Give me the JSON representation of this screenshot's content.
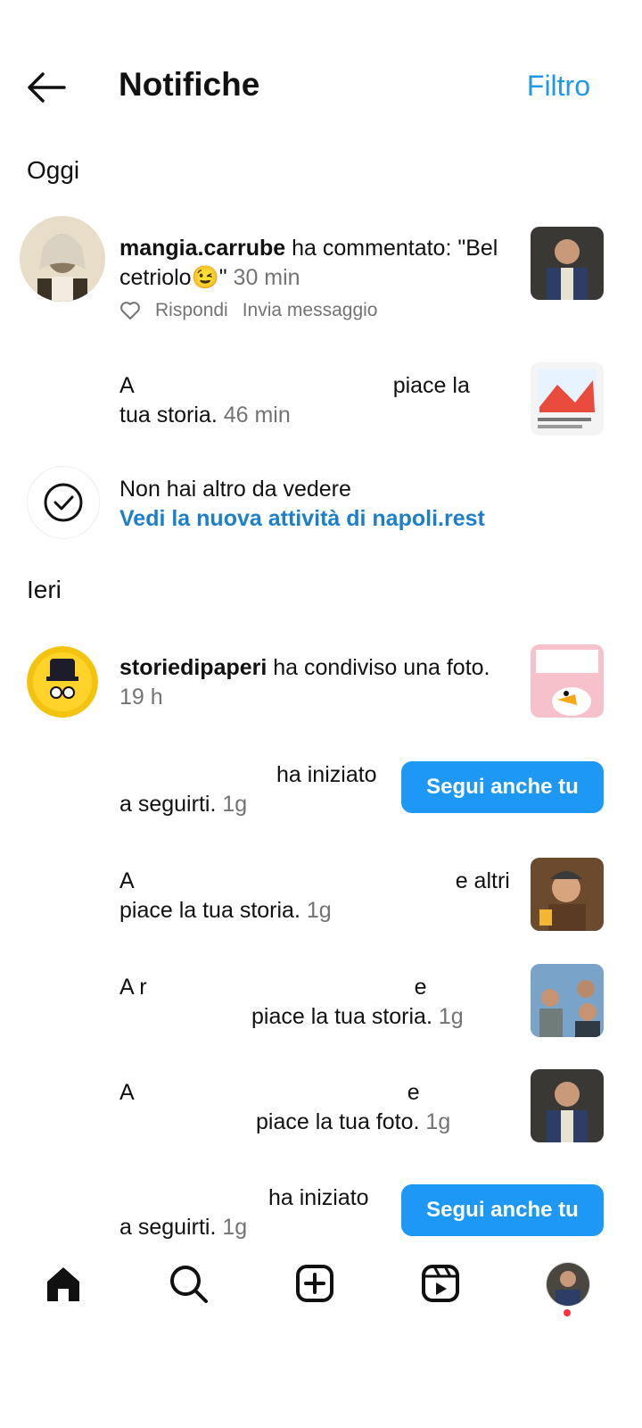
{
  "header": {
    "title": "Notifiche",
    "filter_label": "Filtro"
  },
  "sections": {
    "today": "Oggi",
    "yesterday": "Ieri"
  },
  "notifications": [
    {
      "user": "mangia.carrube",
      "text": " ha commentato: \"Bel cetriolo😉\"",
      "time": " 30 min",
      "like_icon": "heart-outline-icon",
      "reply": "Rispondi",
      "message": "Invia messaggio"
    },
    {
      "prefix": "A",
      "suffix": "piace la",
      "line2": "tua storia.",
      "time": " 46 min"
    },
    {
      "line1": "Non hai altro da vedere",
      "link": "Vedi la nuova attività di napoli.rest"
    },
    {
      "user": "storiedipaperi",
      "text": " ha condiviso una foto.",
      "time": "19 h"
    },
    {
      "suffix": "ha iniziato",
      "line2": "a seguirti.",
      "time": " 1g",
      "button": "Segui anche tu"
    },
    {
      "prefix": "A",
      "suffix": "e altri",
      "line2": "piace la tua storia.",
      "time": " 1g"
    },
    {
      "prefix": "A r",
      "suffix": "e",
      "line2": "piace la tua storia.",
      "time": " 1g"
    },
    {
      "prefix": "A",
      "suffix": "e",
      "line2": "piace la tua foto.",
      "time": " 1g"
    },
    {
      "suffix": "ha iniziato",
      "line2": "a seguirti.",
      "time": " 1g",
      "button": "Segui anche tu"
    }
  ],
  "nav": [
    "home-icon",
    "search-icon",
    "create-icon",
    "reels-icon",
    "profile-avatar"
  ],
  "colors": {
    "accent": "#1e98f5",
    "link": "#1e7fc9",
    "secondary_text": "#737373",
    "notification_dot": "#ff3040"
  }
}
